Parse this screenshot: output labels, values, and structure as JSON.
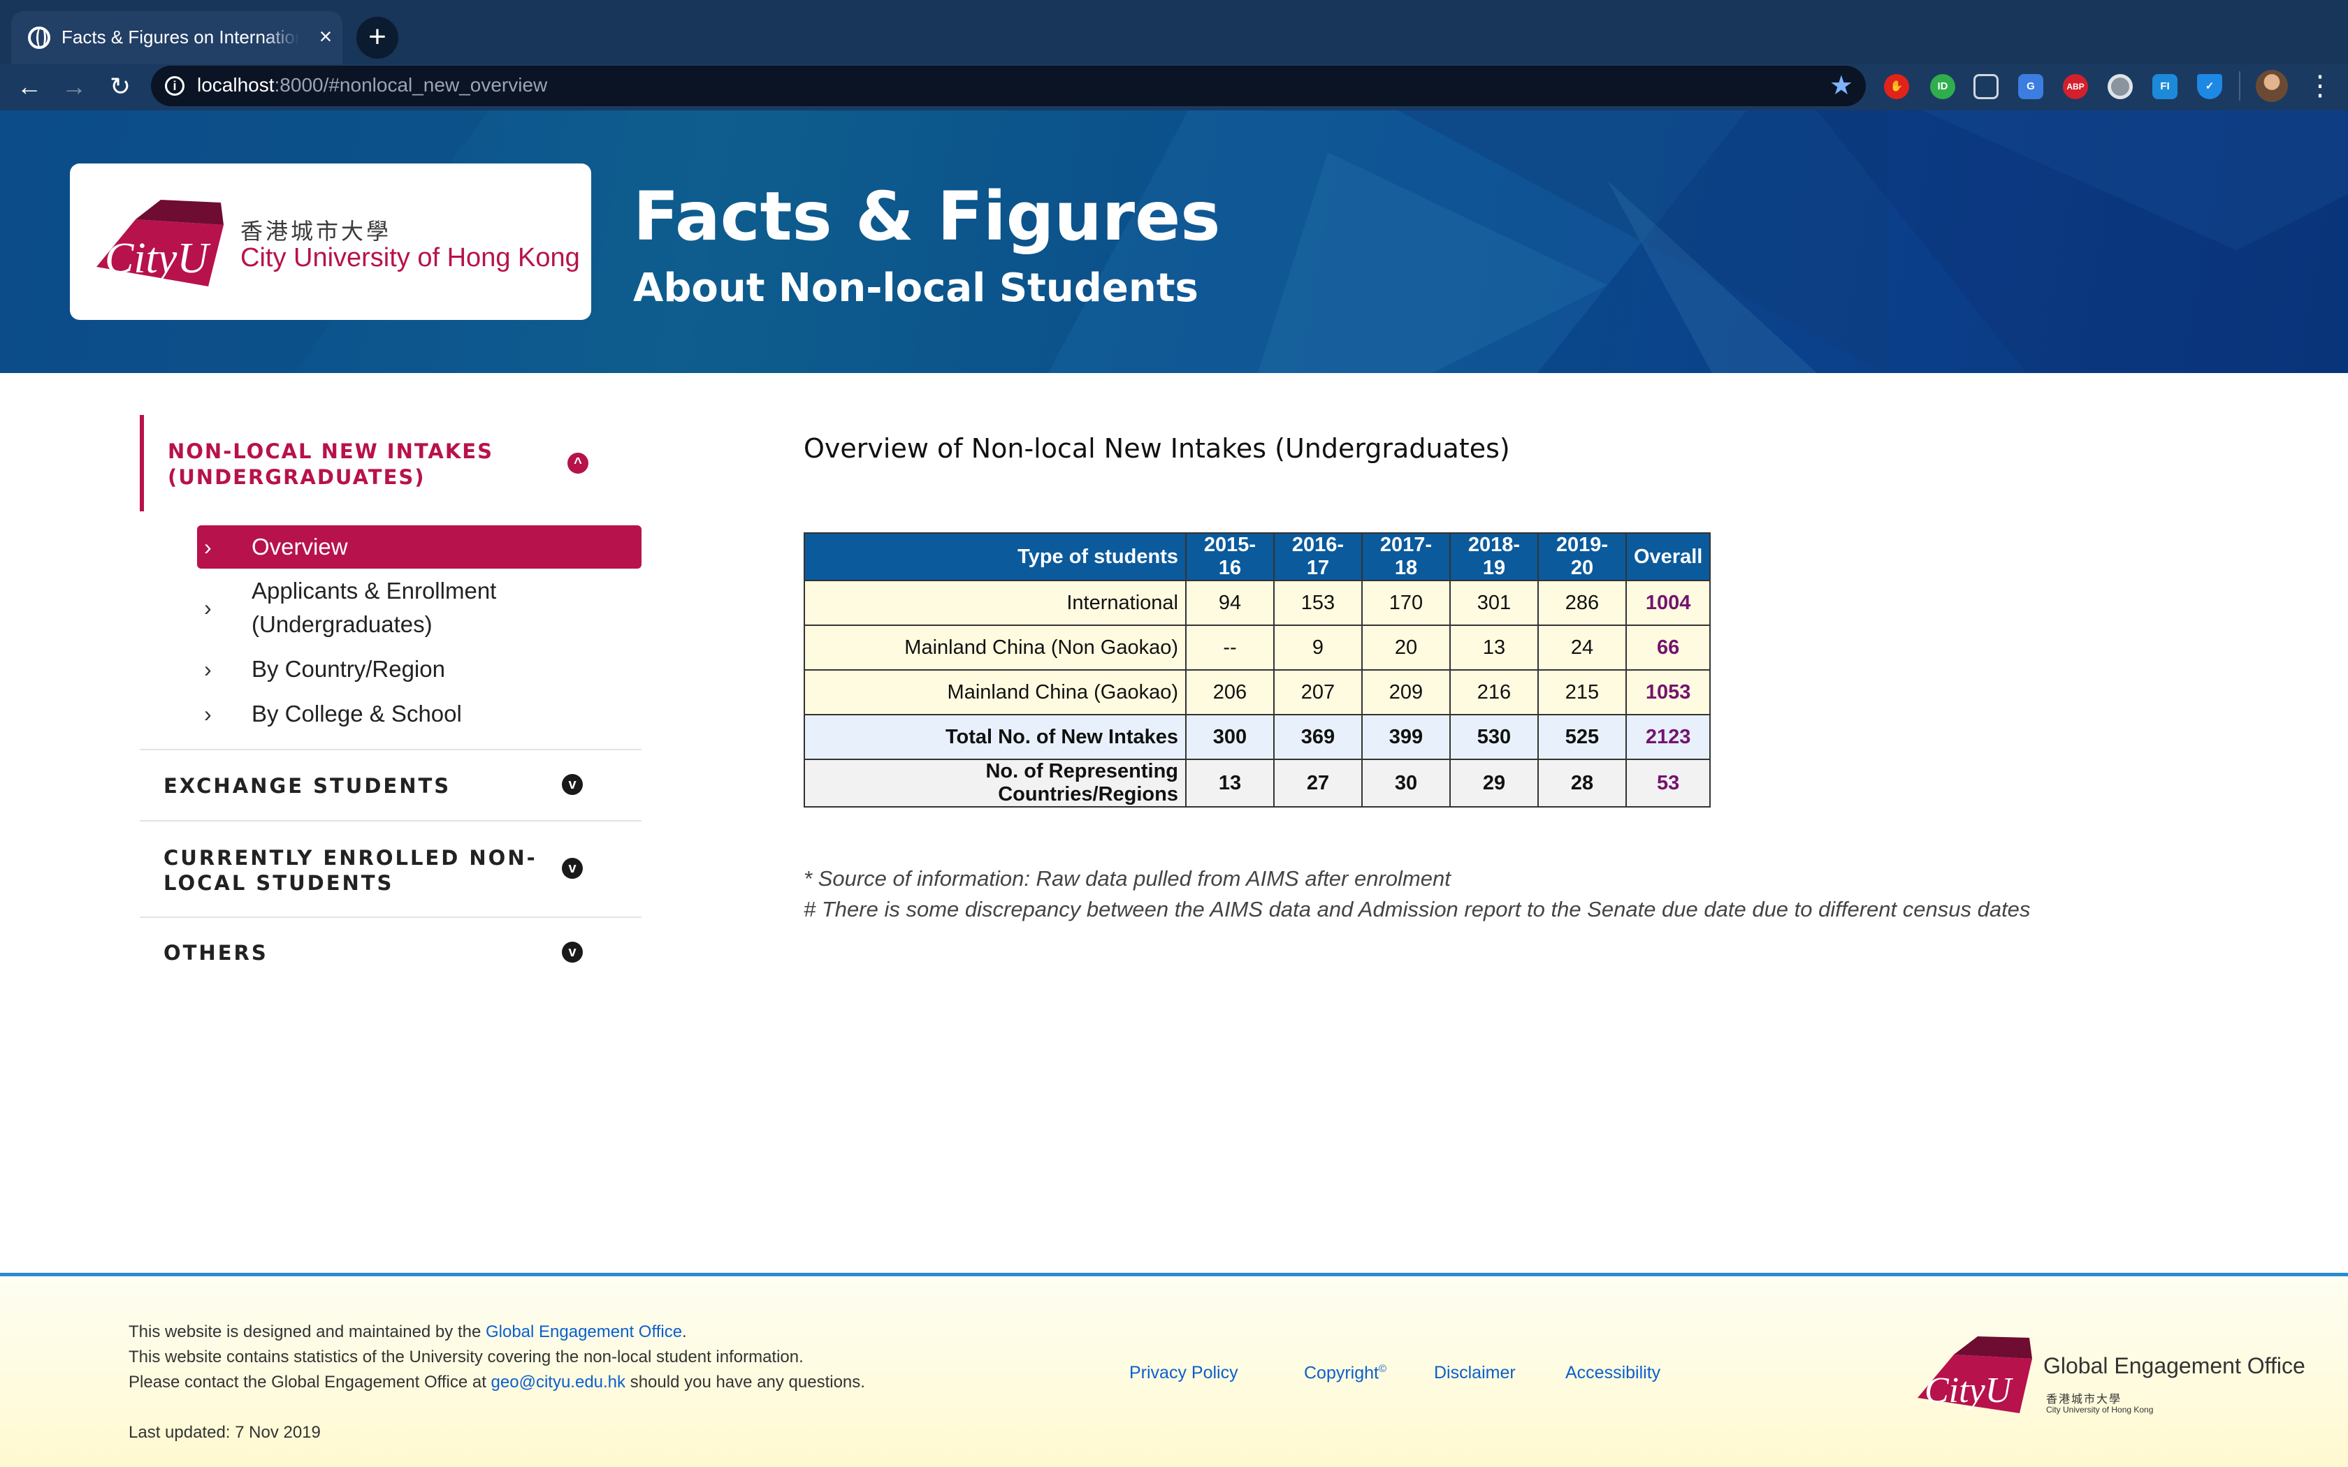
{
  "browser": {
    "tab_title": "Facts & Figures on Internationalisation",
    "url_host": "localhost",
    "url_rest": ":8000/#nonlocal_new_overview"
  },
  "banner": {
    "logo_wordmark": "CityU",
    "logo_chinese": "香港城市大學",
    "logo_english": "City University of Hong Kong",
    "title": "Facts & Figures",
    "subtitle": "About Non-local Students"
  },
  "sidebar": {
    "active_section": "NON-LOCAL NEW INTAKES (UNDERGRADUATES)",
    "sub_items": [
      {
        "label": "Overview"
      },
      {
        "label": "Applicants & Enrollment (Undergraduates)"
      },
      {
        "label": "By Country/Region"
      },
      {
        "label": "By College & School"
      }
    ],
    "sections": [
      {
        "label": "EXCHANGE STUDENTS"
      },
      {
        "label": "CURRENTLY ENROLLED NON-LOCAL STUDENTS"
      },
      {
        "label": "OTHERS"
      }
    ]
  },
  "main": {
    "title": "Overview of Non-local New Intakes (Undergraduates)",
    "table": {
      "headers": [
        "Type of students",
        "2015-16",
        "2016-17",
        "2017-18",
        "2018-19",
        "2019-20",
        "Overall"
      ],
      "rows": [
        [
          "International",
          "94",
          "153",
          "170",
          "301",
          "286",
          "1004"
        ],
        [
          "Mainland China (Non Gaokao)",
          "--",
          "9",
          "20",
          "13",
          "24",
          "66"
        ],
        [
          "Mainland China (Gaokao)",
          "206",
          "207",
          "209",
          "216",
          "215",
          "1053"
        ],
        [
          "Total No. of New Intakes",
          "300",
          "369",
          "399",
          "530",
          "525",
          "2123"
        ],
        [
          "No. of Representing Countries/Regions",
          "13",
          "27",
          "30",
          "29",
          "28",
          "53"
        ]
      ]
    },
    "notes": [
      "* Source of information: Raw data pulled from AIMS after enrolment",
      "# There is some discrepancy between the AIMS data and Admission report to the Senate due date due to different census dates"
    ]
  },
  "footer": {
    "line1_prefix": "This website is designed and maintained by the ",
    "line1_link": "Global Engagement Office",
    "line1_suffix": ".",
    "line2": "This website contains statistics of the University covering the non-local student information.",
    "line3_prefix": "Please contact the Global Engagement Office at ",
    "line3_link": "geo@cityu.edu.hk",
    "line3_suffix": " should you have any questions.",
    "updated": "Last updated: 7 Nov 2019",
    "links": {
      "privacy": "Privacy Policy",
      "copyright": "Copyright",
      "copyright_mark": "©",
      "disclaimer": "Disclaimer",
      "accessibility": "Accessibility"
    },
    "office_wordmark": "CityU",
    "office_title": "Global Engagement Office",
    "office_chinese": "香港城市大學",
    "office_english": "City University of Hong Kong"
  }
}
